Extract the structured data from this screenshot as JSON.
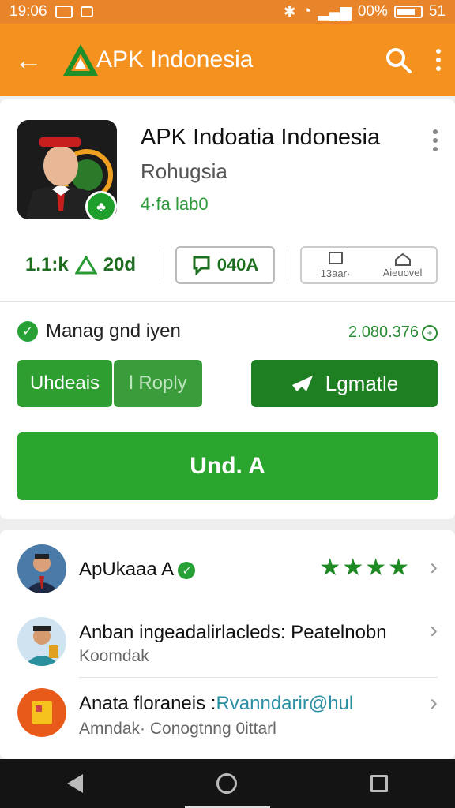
{
  "status_bar": {
    "time": "19:06",
    "battery": "00%",
    "right_text": "51"
  },
  "app_bar": {
    "title": "APK Indonesia",
    "back_icon": "arrow-left-icon",
    "search_icon": "search-icon",
    "more_icon": "more-vert-icon"
  },
  "app": {
    "name": "APK Indoatia Indonesia",
    "developer": "Rohugsia",
    "subtitle": "4·fa lab0",
    "stat_left": "1.1:k",
    "stat_left_suffix": "20d",
    "button_outline_label": "040A",
    "button_cell_1": "13aar·",
    "button_cell_2": "Aieuovel"
  },
  "managed": {
    "label": "Manag gnd iyen",
    "value": "2.080.376"
  },
  "buttons": {
    "updates": "Uhdeais",
    "reply": "l Roply",
    "languages": "Lgmatle",
    "main": "Und. A"
  },
  "list": [
    {
      "title": "ApUkaaa A",
      "sub": "",
      "rating_stars": 4
    },
    {
      "title": "Anban ingeadalirlacleds: Peatelnobn",
      "sub": "Koomdak"
    },
    {
      "title_prefix": "Anata floraneis :",
      "title_accent": "Rvanndarir@hul",
      "sub": "Amndak· Conogtnng 0ittarl"
    }
  ],
  "colors": {
    "appbar": "#f5911e",
    "statusbar": "#e8852a",
    "green": "#2aa52d",
    "dark_green": "#1d7f22"
  }
}
